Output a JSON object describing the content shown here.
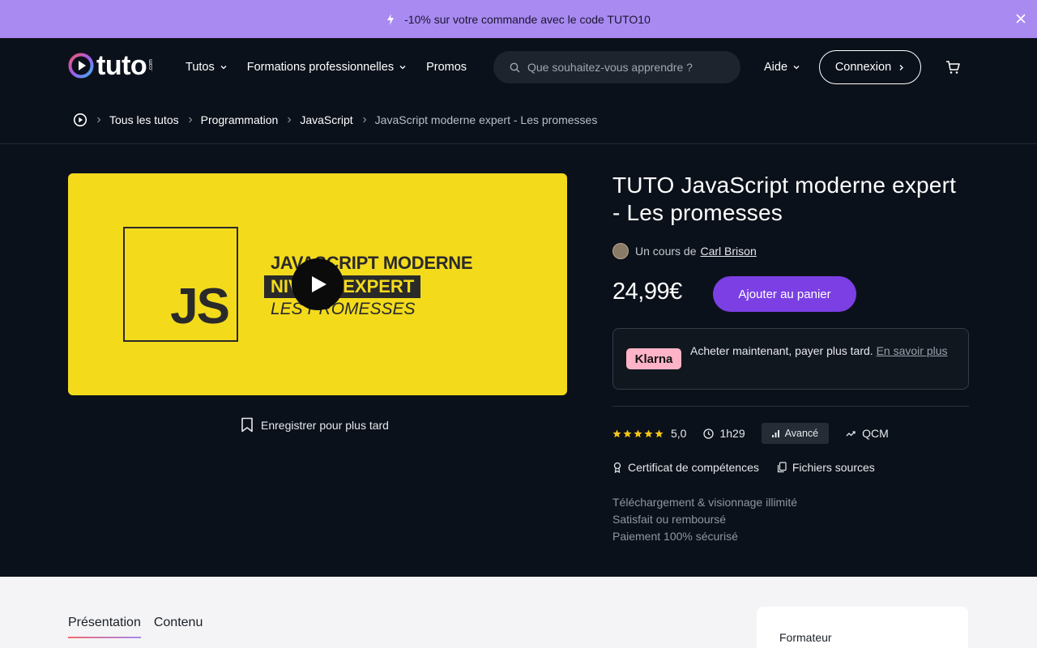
{
  "promo": {
    "text": "-10% sur votre commande avec le code TUTO10"
  },
  "brand": {
    "name": "tuto",
    "tld": ".com"
  },
  "nav": {
    "items": [
      {
        "label": "Tutos"
      },
      {
        "label": "Formations professionnelles"
      },
      {
        "label": "Promos"
      }
    ],
    "search_placeholder": "Que souhaitez-vous apprendre ?",
    "help_label": "Aide",
    "login_label": "Connexion"
  },
  "breadcrumb": {
    "items": [
      "Tous les tutos",
      "Programmation",
      "JavaScript"
    ],
    "current": "JavaScript moderne expert - Les promesses"
  },
  "video": {
    "logo_text": "JS",
    "line1": "JAVASCRIPT MODERNE",
    "line2": "NIVEAU EXPERT",
    "line3": "LES PROMESSES",
    "save_label": "Enregistrer pour plus tard"
  },
  "course": {
    "title": "TUTO JavaScript moderne expert - Les promesses",
    "author_prefix": "Un cours de",
    "author_name": "Carl Brison",
    "price": "24,99€",
    "add_to_cart_label": "Ajouter au panier",
    "klarna": {
      "badge": "Klarna",
      "text": "Acheter maintenant, payer plus tard.",
      "link": "En savoir plus"
    },
    "rating": "5,0",
    "stars": 5,
    "duration": "1h29",
    "level": "Avancé",
    "quiz_label": "QCM",
    "features": [
      "Certificat de compétences",
      "Fichiers sources"
    ],
    "guarantees": [
      "Téléchargement & visionnage illimité",
      "Satisfait ou remboursé",
      "Paiement 100% sécurisé"
    ]
  },
  "tabs": [
    {
      "label": "Présentation",
      "active": true
    },
    {
      "label": "Contenu",
      "active": false
    }
  ],
  "sidebar_card": {
    "title": "Formateur"
  },
  "colors": {
    "promo_bg": "#a98af0",
    "page_bg": "#0b111a",
    "accent": "#7b3fe4",
    "video_bg": "#f3db1c",
    "klarna_pink": "#ffb3c7",
    "star": "#f5c518"
  }
}
